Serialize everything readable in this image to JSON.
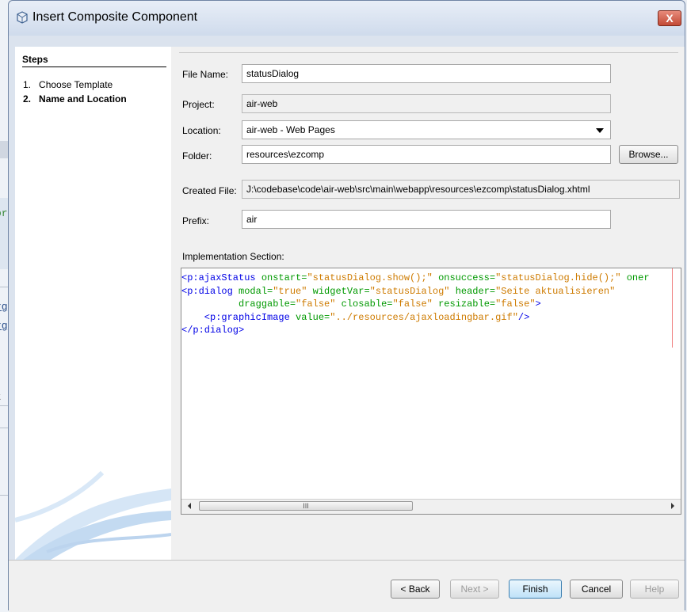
{
  "background": {
    "fragments": [
      "or",
      "rg",
      "rg",
      "t"
    ]
  },
  "window": {
    "title": "Insert Composite Component",
    "close_label": "X"
  },
  "steps": {
    "title": "Steps",
    "items": [
      {
        "num": "1.",
        "label": "Choose Template"
      },
      {
        "num": "2.",
        "label": "Name and Location"
      }
    ]
  },
  "form": {
    "file_name": {
      "label": "File Name:",
      "mnemonic": "N",
      "value": "statusDialog"
    },
    "project": {
      "label": "Project:",
      "mnemonic": "P",
      "value": "air-web"
    },
    "location": {
      "label": "Location:",
      "mnemonic": "L",
      "value": "air-web - Web Pages"
    },
    "folder": {
      "label": "Folder:",
      "mnemonic": "o",
      "value": "resources\\ezcomp",
      "browse_label": "Browse..."
    },
    "created_file": {
      "label": "Created File:",
      "mnemonic": "C",
      "value": "J:\\codebase\\code\\air-web\\src\\main\\webapp\\resources\\ezcomp\\statusDialog.xhtml"
    },
    "prefix": {
      "label": "Prefix:",
      "mnemonic": "x",
      "value": "air"
    },
    "implementation_label": "Implementation Section:"
  },
  "code_lines": [
    [
      [
        "tag",
        "<p:ajaxStatus "
      ],
      [
        "attr",
        "onstart="
      ],
      [
        "val",
        "\"statusDialog.show();\""
      ],
      [
        "attr",
        " onsuccess="
      ],
      [
        "val",
        "\"statusDialog.hide();\""
      ],
      [
        "attr",
        " oner"
      ]
    ],
    [
      [
        "tag",
        "<p:dialog "
      ],
      [
        "attr",
        "modal="
      ],
      [
        "val",
        "\"true\""
      ],
      [
        "attr",
        " widgetVar="
      ],
      [
        "val",
        "\"statusDialog\""
      ],
      [
        "attr",
        " header="
      ],
      [
        "val",
        "\"Seite aktualisieren\""
      ]
    ],
    [
      [
        "attr",
        "          draggable="
      ],
      [
        "val",
        "\"false\""
      ],
      [
        "attr",
        " closable="
      ],
      [
        "val",
        "\"false\""
      ],
      [
        "attr",
        " resizable="
      ],
      [
        "val",
        "\"false\""
      ],
      [
        "tag",
        ">"
      ]
    ],
    [
      [
        "tag",
        "    <p:graphicImage "
      ],
      [
        "attr",
        "value="
      ],
      [
        "val",
        "\"../resources/ajaxloadingbar.gif\""
      ],
      [
        "tag",
        "/>"
      ]
    ],
    [
      [
        "tag",
        "</p:dialog>"
      ]
    ]
  ],
  "scrollbar": {
    "grip": "III"
  },
  "buttons": {
    "back": "< Back",
    "next": "Next >",
    "finish": "Finish",
    "cancel": "Cancel",
    "help": "Help"
  }
}
